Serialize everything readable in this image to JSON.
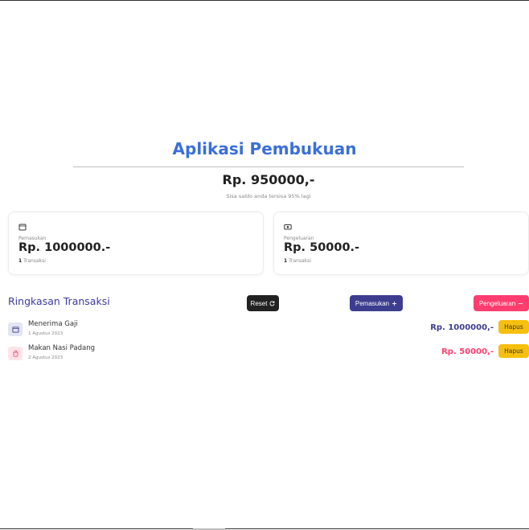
{
  "app": {
    "title": "Aplikasi Pembukuan",
    "balance": "Rp. 950000,-",
    "balance_note": "Sisa saldo anda tersisa 95% lagi"
  },
  "cards": {
    "income": {
      "icon": "wallet-icon",
      "label": "Pemasukan",
      "amount": "Rp. 1000000.-",
      "count": "1",
      "count_suffix": " Transaksi"
    },
    "expense": {
      "icon": "cash-icon",
      "label": "Pengeluaran",
      "amount": "Rp. 50000.-",
      "count": "1",
      "count_suffix": " Transaksi"
    }
  },
  "summary": {
    "title": "Ringkasan Transaksi",
    "reset_label": "Reset",
    "income_label": "Pemasukan",
    "expense_label": "Pengeluaran"
  },
  "transactions": [
    {
      "name": "Menerima Gaji",
      "date": "1 Agustus 2023",
      "amount": "Rp. 1000000,-",
      "type": "income",
      "icon": "wallet-icon",
      "delete_label": "Hapus"
    },
    {
      "name": "Makan Nasi Padang",
      "date": "2 Agustus 2023",
      "amount": "Rp. 50000,-",
      "type": "expense",
      "icon": "bag-icon",
      "delete_label": "Hapus"
    }
  ],
  "colors": {
    "title": "#3b6fd8",
    "income": "#3d3d8f",
    "expense": "#ff3d6e",
    "delete": "#f7bf0e"
  }
}
